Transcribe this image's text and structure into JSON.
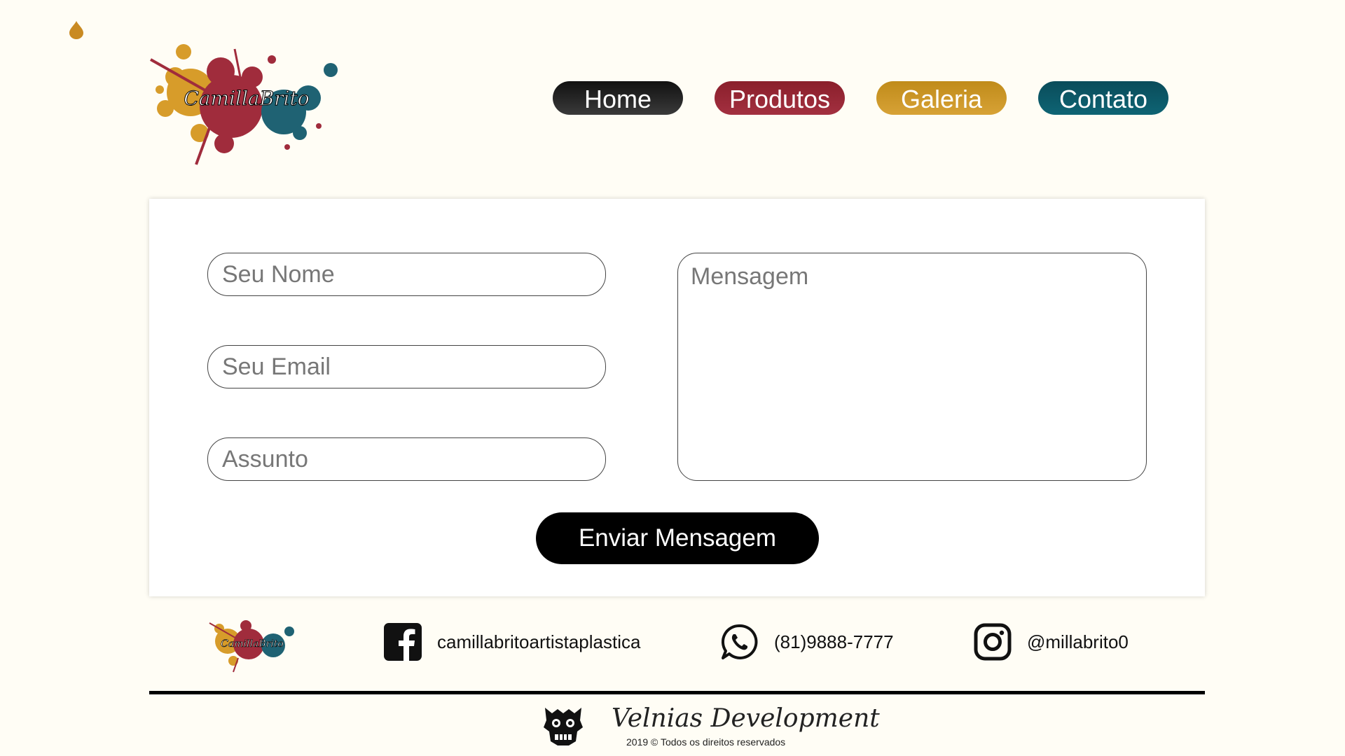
{
  "header": {
    "logo_signature": "CamillaBrito"
  },
  "nav": {
    "items": [
      {
        "label": "Home",
        "color": "#111111"
      },
      {
        "label": "Produtos",
        "color": "#8a1f2b"
      },
      {
        "label": "Galeria",
        "color": "#c08b1a"
      },
      {
        "label": "Contato",
        "color": "#0a4c5a"
      }
    ]
  },
  "form": {
    "name_placeholder": "Seu Nome",
    "email_placeholder": "Seu Email",
    "subject_placeholder": "Assunto",
    "message_placeholder": "Mensagem",
    "name_value": "",
    "email_value": "",
    "subject_value": "",
    "message_value": "",
    "submit_label": "Enviar Mensagem"
  },
  "footer": {
    "social": [
      {
        "icon": "facebook-icon",
        "text": "camillabritoartistaplastica"
      },
      {
        "icon": "whatsapp-icon",
        "text": "(81)9888-7777"
      },
      {
        "icon": "instagram-icon",
        "text": "@millabrito0"
      }
    ],
    "developer": {
      "icon": "tribal-mask-icon",
      "name": "Velnias Development",
      "copyright": "2019 © Todos os direitos reservados"
    }
  }
}
